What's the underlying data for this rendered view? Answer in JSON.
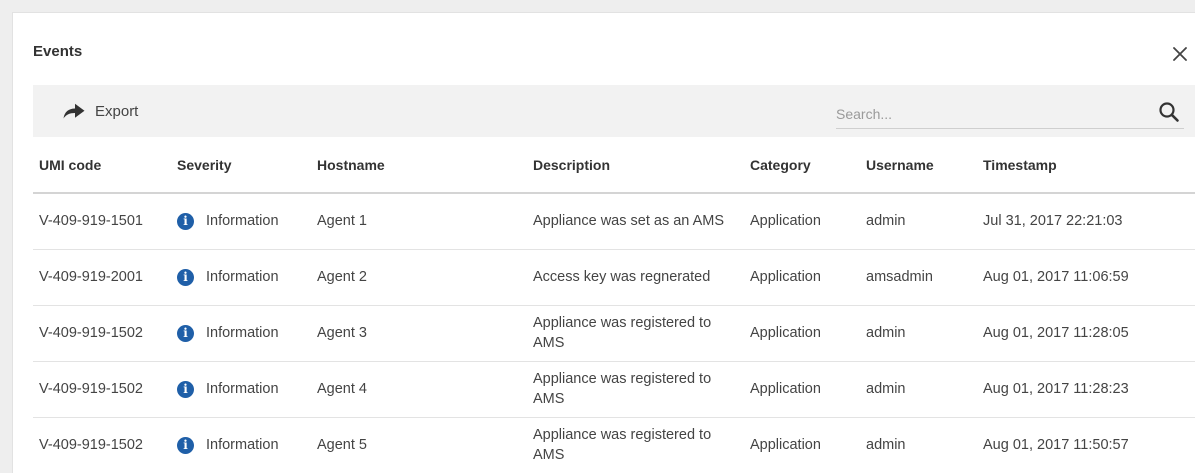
{
  "dialog": {
    "title": "Events",
    "close_glyph": "✕"
  },
  "toolbar": {
    "export_label": "Export",
    "export_icon": "share-arrow-icon",
    "search_placeholder": "Search...",
    "search_icon": "search-icon"
  },
  "table": {
    "columns": [
      "UMI code",
      "Severity",
      "Hostname",
      "Description",
      "Category",
      "Username",
      "Timestamp"
    ],
    "rows": [
      {
        "umi": "V-409-919-1501",
        "severity": "Information",
        "hostname": "Agent 1",
        "description": "Appliance was set as an AMS",
        "category": "Application",
        "username": "admin",
        "timestamp": "Jul 31, 2017 22:21:03"
      },
      {
        "umi": "V-409-919-2001",
        "severity": "Information",
        "hostname": "Agent 2",
        "description": "Access key was regnerated",
        "category": "Application",
        "username": "amsadmin",
        "timestamp": "Aug 01, 2017 11:06:59"
      },
      {
        "umi": "V-409-919-1502",
        "severity": "Information",
        "hostname": "Agent 3",
        "description": "Appliance was registered to AMS",
        "category": "Application",
        "username": "admin",
        "timestamp": "Aug 01, 2017 11:28:05"
      },
      {
        "umi": "V-409-919-1502",
        "severity": "Information",
        "hostname": "Agent 4",
        "description": "Appliance was registered to AMS",
        "category": "Application",
        "username": "admin",
        "timestamp": "Aug 01, 2017 11:28:23"
      },
      {
        "umi": "V-409-919-1502",
        "severity": "Information",
        "hostname": "Agent 5",
        "description": "Appliance was registered to AMS",
        "category": "Application",
        "username": "admin",
        "timestamp": "Aug 01, 2017 11:50:57"
      }
    ]
  },
  "colors": {
    "info_icon": "#1f5fa8",
    "toolbar_bg": "#f2f2f2",
    "page_bg": "#eeeeee"
  }
}
